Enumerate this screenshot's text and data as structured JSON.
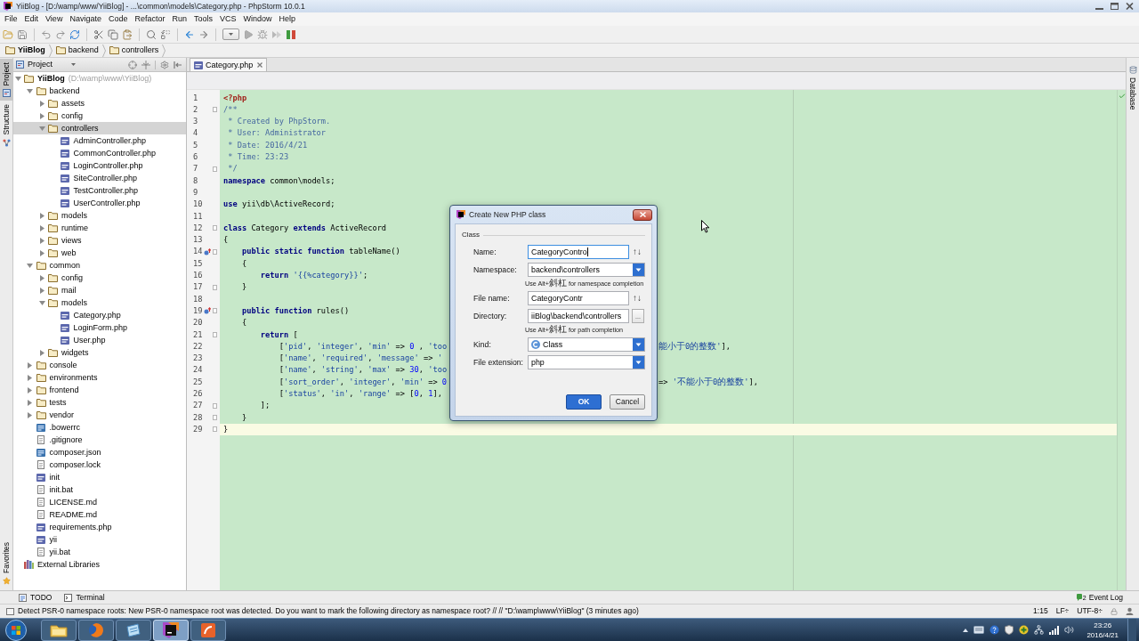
{
  "window": {
    "title": "YiiBlog - [D:/wamp/www/YiiBlog] - ...\\common\\models\\Category.php - PhpStorm 10.0.1"
  },
  "menu": [
    "File",
    "Edit",
    "View",
    "Navigate",
    "Code",
    "Refactor",
    "Run",
    "Tools",
    "VCS",
    "Window",
    "Help"
  ],
  "breadcrumbs": [
    {
      "label": "YiiBlog",
      "kind": "project"
    },
    {
      "label": "backend",
      "kind": "folder"
    },
    {
      "label": "controllers",
      "kind": "folder"
    }
  ],
  "left_strip": {
    "top": [
      {
        "label": "Project",
        "kind": "project",
        "selected": true
      },
      {
        "label": "Structure",
        "kind": "structure",
        "selected": false
      }
    ],
    "bottom": [
      {
        "label": "Favorites",
        "kind": "favorites",
        "selected": false
      }
    ]
  },
  "project_panel": {
    "view": "Project",
    "tree": [
      {
        "label": "YiiBlog",
        "path": "(D:\\wamp\\www\\YiiBlog)",
        "kind": "project",
        "expanded": true,
        "selected": false,
        "children": [
          {
            "label": "backend",
            "kind": "folder",
            "expanded": true,
            "selected": false,
            "children": [
              {
                "label": "assets",
                "kind": "folder",
                "expanded": false,
                "selected": false
              },
              {
                "label": "config",
                "kind": "folder",
                "expanded": false,
                "selected": false
              },
              {
                "label": "controllers",
                "kind": "folder",
                "expanded": true,
                "selected": true,
                "children": [
                  {
                    "label": "AdminController.php",
                    "kind": "php",
                    "selected": false
                  },
                  {
                    "label": "CommonController.php",
                    "kind": "php",
                    "selected": false
                  },
                  {
                    "label": "LoginController.php",
                    "kind": "php",
                    "selected": false
                  },
                  {
                    "label": "SiteController.php",
                    "kind": "php",
                    "selected": false
                  },
                  {
                    "label": "TestController.php",
                    "kind": "php",
                    "selected": false
                  },
                  {
                    "label": "UserController.php",
                    "kind": "php",
                    "selected": false
                  }
                ]
              },
              {
                "label": "models",
                "kind": "folder",
                "expanded": false,
                "selected": false
              },
              {
                "label": "runtime",
                "kind": "folder",
                "expanded": false,
                "selected": false
              },
              {
                "label": "views",
                "kind": "folder",
                "expanded": false,
                "selected": false
              },
              {
                "label": "web",
                "kind": "folder",
                "expanded": false,
                "selected": false
              }
            ]
          },
          {
            "label": "common",
            "kind": "folder",
            "expanded": true,
            "selected": false,
            "children": [
              {
                "label": "config",
                "kind": "folder",
                "expanded": false,
                "selected": false
              },
              {
                "label": "mail",
                "kind": "folder",
                "expanded": false,
                "selected": false
              },
              {
                "label": "models",
                "kind": "folder",
                "expanded": true,
                "selected": false,
                "children": [
                  {
                    "label": "Category.php",
                    "kind": "php",
                    "selected": false
                  },
                  {
                    "label": "LoginForm.php",
                    "kind": "php",
                    "selected": false
                  },
                  {
                    "label": "User.php",
                    "kind": "php",
                    "selected": false
                  }
                ]
              },
              {
                "label": "widgets",
                "kind": "folder",
                "expanded": false,
                "selected": false
              }
            ]
          },
          {
            "label": "console",
            "kind": "folder",
            "expanded": false,
            "selected": false
          },
          {
            "label": "environments",
            "kind": "folder",
            "expanded": false,
            "selected": false
          },
          {
            "label": "frontend",
            "kind": "folder",
            "expanded": false,
            "selected": false
          },
          {
            "label": "tests",
            "kind": "folder",
            "expanded": false,
            "selected": false
          },
          {
            "label": "vendor",
            "kind": "folder",
            "expanded": false,
            "selected": false
          },
          {
            "label": ".bowerrc",
            "kind": "json",
            "selected": false
          },
          {
            "label": ".gitignore",
            "kind": "text",
            "selected": false
          },
          {
            "label": "composer.json",
            "kind": "json",
            "selected": false
          },
          {
            "label": "composer.lock",
            "kind": "text",
            "selected": false
          },
          {
            "label": "init",
            "kind": "php",
            "selected": false
          },
          {
            "label": "init.bat",
            "kind": "text",
            "selected": false
          },
          {
            "label": "LICENSE.md",
            "kind": "text",
            "selected": false
          },
          {
            "label": "README.md",
            "kind": "text",
            "selected": false
          },
          {
            "label": "requirements.php",
            "kind": "php",
            "selected": false
          },
          {
            "label": "yii",
            "kind": "php",
            "selected": false
          },
          {
            "label": "yii.bat",
            "kind": "text",
            "selected": false
          }
        ]
      },
      {
        "label": "External Libraries",
        "kind": "library",
        "selected": false
      }
    ]
  },
  "editor": {
    "tabs": [
      {
        "label": "Category.php",
        "kind": "php",
        "selected": true
      }
    ],
    "lines": [
      {
        "number": "1",
        "current": false,
        "overrides": false,
        "fold": false,
        "tokens": [
          {
            "kind": "tag",
            "text": "<?php"
          }
        ]
      },
      {
        "number": "2",
        "current": false,
        "overrides": false,
        "fold": true,
        "tokens": [
          {
            "kind": "comment",
            "text": "/**"
          }
        ]
      },
      {
        "number": "3",
        "current": false,
        "overrides": false,
        "fold": false,
        "tokens": [
          {
            "kind": "comment",
            "text": " * Created by PhpStorm."
          }
        ]
      },
      {
        "number": "4",
        "current": false,
        "overrides": false,
        "fold": false,
        "tokens": [
          {
            "kind": "comment",
            "text": " * User: Administrator"
          }
        ]
      },
      {
        "number": "5",
        "current": false,
        "overrides": false,
        "fold": false,
        "tokens": [
          {
            "kind": "comment",
            "text": " * Date: 2016/4/21"
          }
        ]
      },
      {
        "number": "6",
        "current": false,
        "overrides": false,
        "fold": false,
        "tokens": [
          {
            "kind": "comment",
            "text": " * Time: 23:23"
          }
        ]
      },
      {
        "number": "7",
        "current": false,
        "overrides": false,
        "fold": true,
        "tokens": [
          {
            "kind": "comment",
            "text": " */"
          }
        ]
      },
      {
        "number": "8",
        "current": false,
        "overrides": false,
        "fold": false,
        "tokens": [
          {
            "kind": "keyword",
            "text": "namespace"
          },
          {
            "kind": "plain",
            "text": " common\\models;"
          }
        ]
      },
      {
        "number": "9",
        "current": false,
        "overrides": false,
        "fold": false
      },
      {
        "number": "10",
        "current": false,
        "overrides": false,
        "fold": false,
        "tokens": [
          {
            "kind": "keyword",
            "text": "use"
          },
          {
            "kind": "plain",
            "text": " yii\\db\\ActiveRecord;"
          }
        ]
      },
      {
        "number": "11",
        "current": false,
        "overrides": false,
        "fold": false
      },
      {
        "number": "12",
        "current": false,
        "overrides": false,
        "fold": true,
        "tokens": [
          {
            "kind": "keyword",
            "text": "class"
          },
          {
            "kind": "plain",
            "text": " Category "
          },
          {
            "kind": "keyword",
            "text": "extends"
          },
          {
            "kind": "plain",
            "text": " ActiveRecord"
          }
        ]
      },
      {
        "number": "13",
        "current": false,
        "overrides": false,
        "fold": false,
        "tokens": [
          {
            "kind": "plain",
            "text": "{"
          }
        ]
      },
      {
        "number": "14",
        "current": false,
        "overrides": true,
        "fold": true,
        "tokens": [
          {
            "kind": "keyword",
            "text": "    public static function"
          },
          {
            "kind": "plain",
            "text": " tableName()"
          }
        ]
      },
      {
        "number": "15",
        "current": false,
        "overrides": false,
        "fold": false,
        "tokens": [
          {
            "kind": "plain",
            "text": "    {"
          }
        ]
      },
      {
        "number": "16",
        "current": false,
        "overrides": false,
        "fold": false,
        "tokens": [
          {
            "kind": "keyword",
            "text": "        return"
          },
          {
            "kind": "string",
            "text": " '{{%category}}'"
          },
          {
            "kind": "plain",
            "text": ";"
          }
        ]
      },
      {
        "number": "17",
        "current": false,
        "overrides": false,
        "fold": true,
        "tokens": [
          {
            "kind": "plain",
            "text": "    }"
          }
        ]
      },
      {
        "number": "18",
        "current": false,
        "overrides": false,
        "fold": false
      },
      {
        "number": "19",
        "current": false,
        "overrides": true,
        "fold": true,
        "tokens": [
          {
            "kind": "keyword",
            "text": "    public function"
          },
          {
            "kind": "plain",
            "text": " rules()"
          }
        ]
      },
      {
        "number": "20",
        "current": false,
        "overrides": false,
        "fold": false,
        "tokens": [
          {
            "kind": "plain",
            "text": "    {"
          }
        ]
      },
      {
        "number": "21",
        "current": false,
        "overrides": false,
        "fold": true,
        "tokens": [
          {
            "kind": "keyword",
            "text": "        return"
          },
          {
            "kind": "plain",
            "text": " ["
          }
        ]
      },
      {
        "number": "22",
        "current": false,
        "overrides": false,
        "fold": false,
        "tokens": [
          {
            "kind": "plain",
            "text": "            ["
          },
          {
            "kind": "string",
            "text": "'pid'"
          },
          {
            "kind": "plain",
            "text": ", "
          },
          {
            "kind": "string",
            "text": "'integer'"
          },
          {
            "kind": "plain",
            "text": ", "
          },
          {
            "kind": "string",
            "text": "'min'"
          },
          {
            "kind": "plain",
            "text": " => "
          },
          {
            "kind": "number",
            "text": "0"
          },
          {
            "kind": "plain",
            "text": " , "
          },
          {
            "kind": "string",
            "text": "'too"
          }
        ],
        "tail": [
          {
            "kind": "string",
            "text": "能小于0的整数'"
          },
          {
            "kind": "plain",
            "text": "],"
          }
        ]
      },
      {
        "number": "23",
        "current": false,
        "overrides": false,
        "fold": false,
        "tokens": [
          {
            "kind": "plain",
            "text": "            ["
          },
          {
            "kind": "string",
            "text": "'name'"
          },
          {
            "kind": "plain",
            "text": ", "
          },
          {
            "kind": "string",
            "text": "'required'"
          },
          {
            "kind": "plain",
            "text": ", "
          },
          {
            "kind": "string",
            "text": "'message'"
          },
          {
            "kind": "plain",
            "text": " => "
          },
          {
            "kind": "string",
            "text": "'"
          }
        ]
      },
      {
        "number": "24",
        "current": false,
        "overrides": false,
        "fold": false,
        "tokens": [
          {
            "kind": "plain",
            "text": "            ["
          },
          {
            "kind": "string",
            "text": "'name'"
          },
          {
            "kind": "plain",
            "text": ", "
          },
          {
            "kind": "string",
            "text": "'string'"
          },
          {
            "kind": "plain",
            "text": ", "
          },
          {
            "kind": "string",
            "text": "'max'"
          },
          {
            "kind": "plain",
            "text": " => "
          },
          {
            "kind": "number",
            "text": "30"
          },
          {
            "kind": "plain",
            "text": ", "
          },
          {
            "kind": "string",
            "text": "'too"
          }
        ]
      },
      {
        "number": "25",
        "current": false,
        "overrides": false,
        "fold": false,
        "tokens": [
          {
            "kind": "plain",
            "text": "            ["
          },
          {
            "kind": "string",
            "text": "'sort_order'"
          },
          {
            "kind": "plain",
            "text": ", "
          },
          {
            "kind": "string",
            "text": "'integer'"
          },
          {
            "kind": "plain",
            "text": ", "
          },
          {
            "kind": "string",
            "text": "'min'"
          },
          {
            "kind": "plain",
            "text": " => "
          },
          {
            "kind": "number",
            "text": "0"
          }
        ],
        "tail": [
          {
            "kind": "plain",
            "text": "=> "
          },
          {
            "kind": "string",
            "text": "'不能小于0的整数'"
          },
          {
            "kind": "plain",
            "text": "],"
          }
        ]
      },
      {
        "number": "26",
        "current": false,
        "overrides": false,
        "fold": false,
        "tokens": [
          {
            "kind": "plain",
            "text": "            ["
          },
          {
            "kind": "string",
            "text": "'status'"
          },
          {
            "kind": "plain",
            "text": ", "
          },
          {
            "kind": "string",
            "text": "'in'"
          },
          {
            "kind": "plain",
            "text": ", "
          },
          {
            "kind": "string",
            "text": "'range'"
          },
          {
            "kind": "plain",
            "text": " => ["
          },
          {
            "kind": "number",
            "text": "0"
          },
          {
            "kind": "plain",
            "text": ", "
          },
          {
            "kind": "number",
            "text": "1"
          },
          {
            "kind": "plain",
            "text": "],"
          }
        ]
      },
      {
        "number": "27",
        "current": false,
        "overrides": false,
        "fold": true,
        "tokens": [
          {
            "kind": "plain",
            "text": "        ];"
          }
        ]
      },
      {
        "number": "28",
        "current": false,
        "overrides": false,
        "fold": true,
        "tokens": [
          {
            "kind": "plain",
            "text": "    }"
          }
        ]
      },
      {
        "number": "29",
        "current": true,
        "overrides": false,
        "fold": true,
        "tokens": [
          {
            "kind": "plain",
            "text": "}"
          }
        ]
      }
    ]
  },
  "right_strip": [
    {
      "label": "Database",
      "selected": false
    }
  ],
  "dialog": {
    "title": "Create New PHP class",
    "group": "Class",
    "fields": [
      {
        "kind": "text",
        "label": "Name:",
        "value": "CategoryContro",
        "focused": true,
        "suffix": "↑↓"
      },
      {
        "kind": "combo",
        "label": "Namespace:",
        "value": "backend\\controllers",
        "focused": false,
        "hint": "Use Alt+斜杠 for namespace completion"
      },
      {
        "kind": "text",
        "label": "File name:",
        "value": "CategoryContr",
        "focused": false,
        "suffix": "↑↓"
      },
      {
        "kind": "browse",
        "label": "Directory:",
        "value": "iiBlog\\backend\\controllers",
        "focused": false,
        "button": "...",
        "hint": "Use Alt+斜杠 for path completion"
      },
      {
        "kind": "class_combo",
        "label": "Kind:",
        "value": "Class",
        "focused": false
      },
      {
        "kind": "combo",
        "label": "File extension:",
        "value": "php",
        "focused": false
      }
    ],
    "buttons": [
      {
        "label": "OK",
        "default": true
      },
      {
        "label": "Cancel",
        "default": false
      }
    ]
  },
  "bottom_tools": [
    {
      "label": "TODO",
      "kind": "todo",
      "selected": false
    },
    {
      "label": "Terminal",
      "kind": "terminal",
      "selected": false
    }
  ],
  "event_log": {
    "count": "2",
    "label": "Event Log"
  },
  "status_bar": {
    "message": "Detect PSR-0 namespace roots: New PSR-0 namespace root was detected. Do you want to mark the following directory as namespace root? // // \"D:\\wamp\\www\\YiiBlog\" (3 minutes ago)",
    "caret_position": "1:15",
    "line_separator": "LF÷",
    "encoding": "UTF-8÷"
  },
  "taskbar": {
    "apps": [
      {
        "kind": "explorer",
        "selected": false
      },
      {
        "kind": "browser",
        "selected": false
      },
      {
        "kind": "notes",
        "selected": false
      },
      {
        "kind": "ide",
        "selected": true
      },
      {
        "kind": "pdf",
        "selected": false
      }
    ],
    "clock": {
      "time": "23:26",
      "date": "2016/4/21"
    }
  }
}
